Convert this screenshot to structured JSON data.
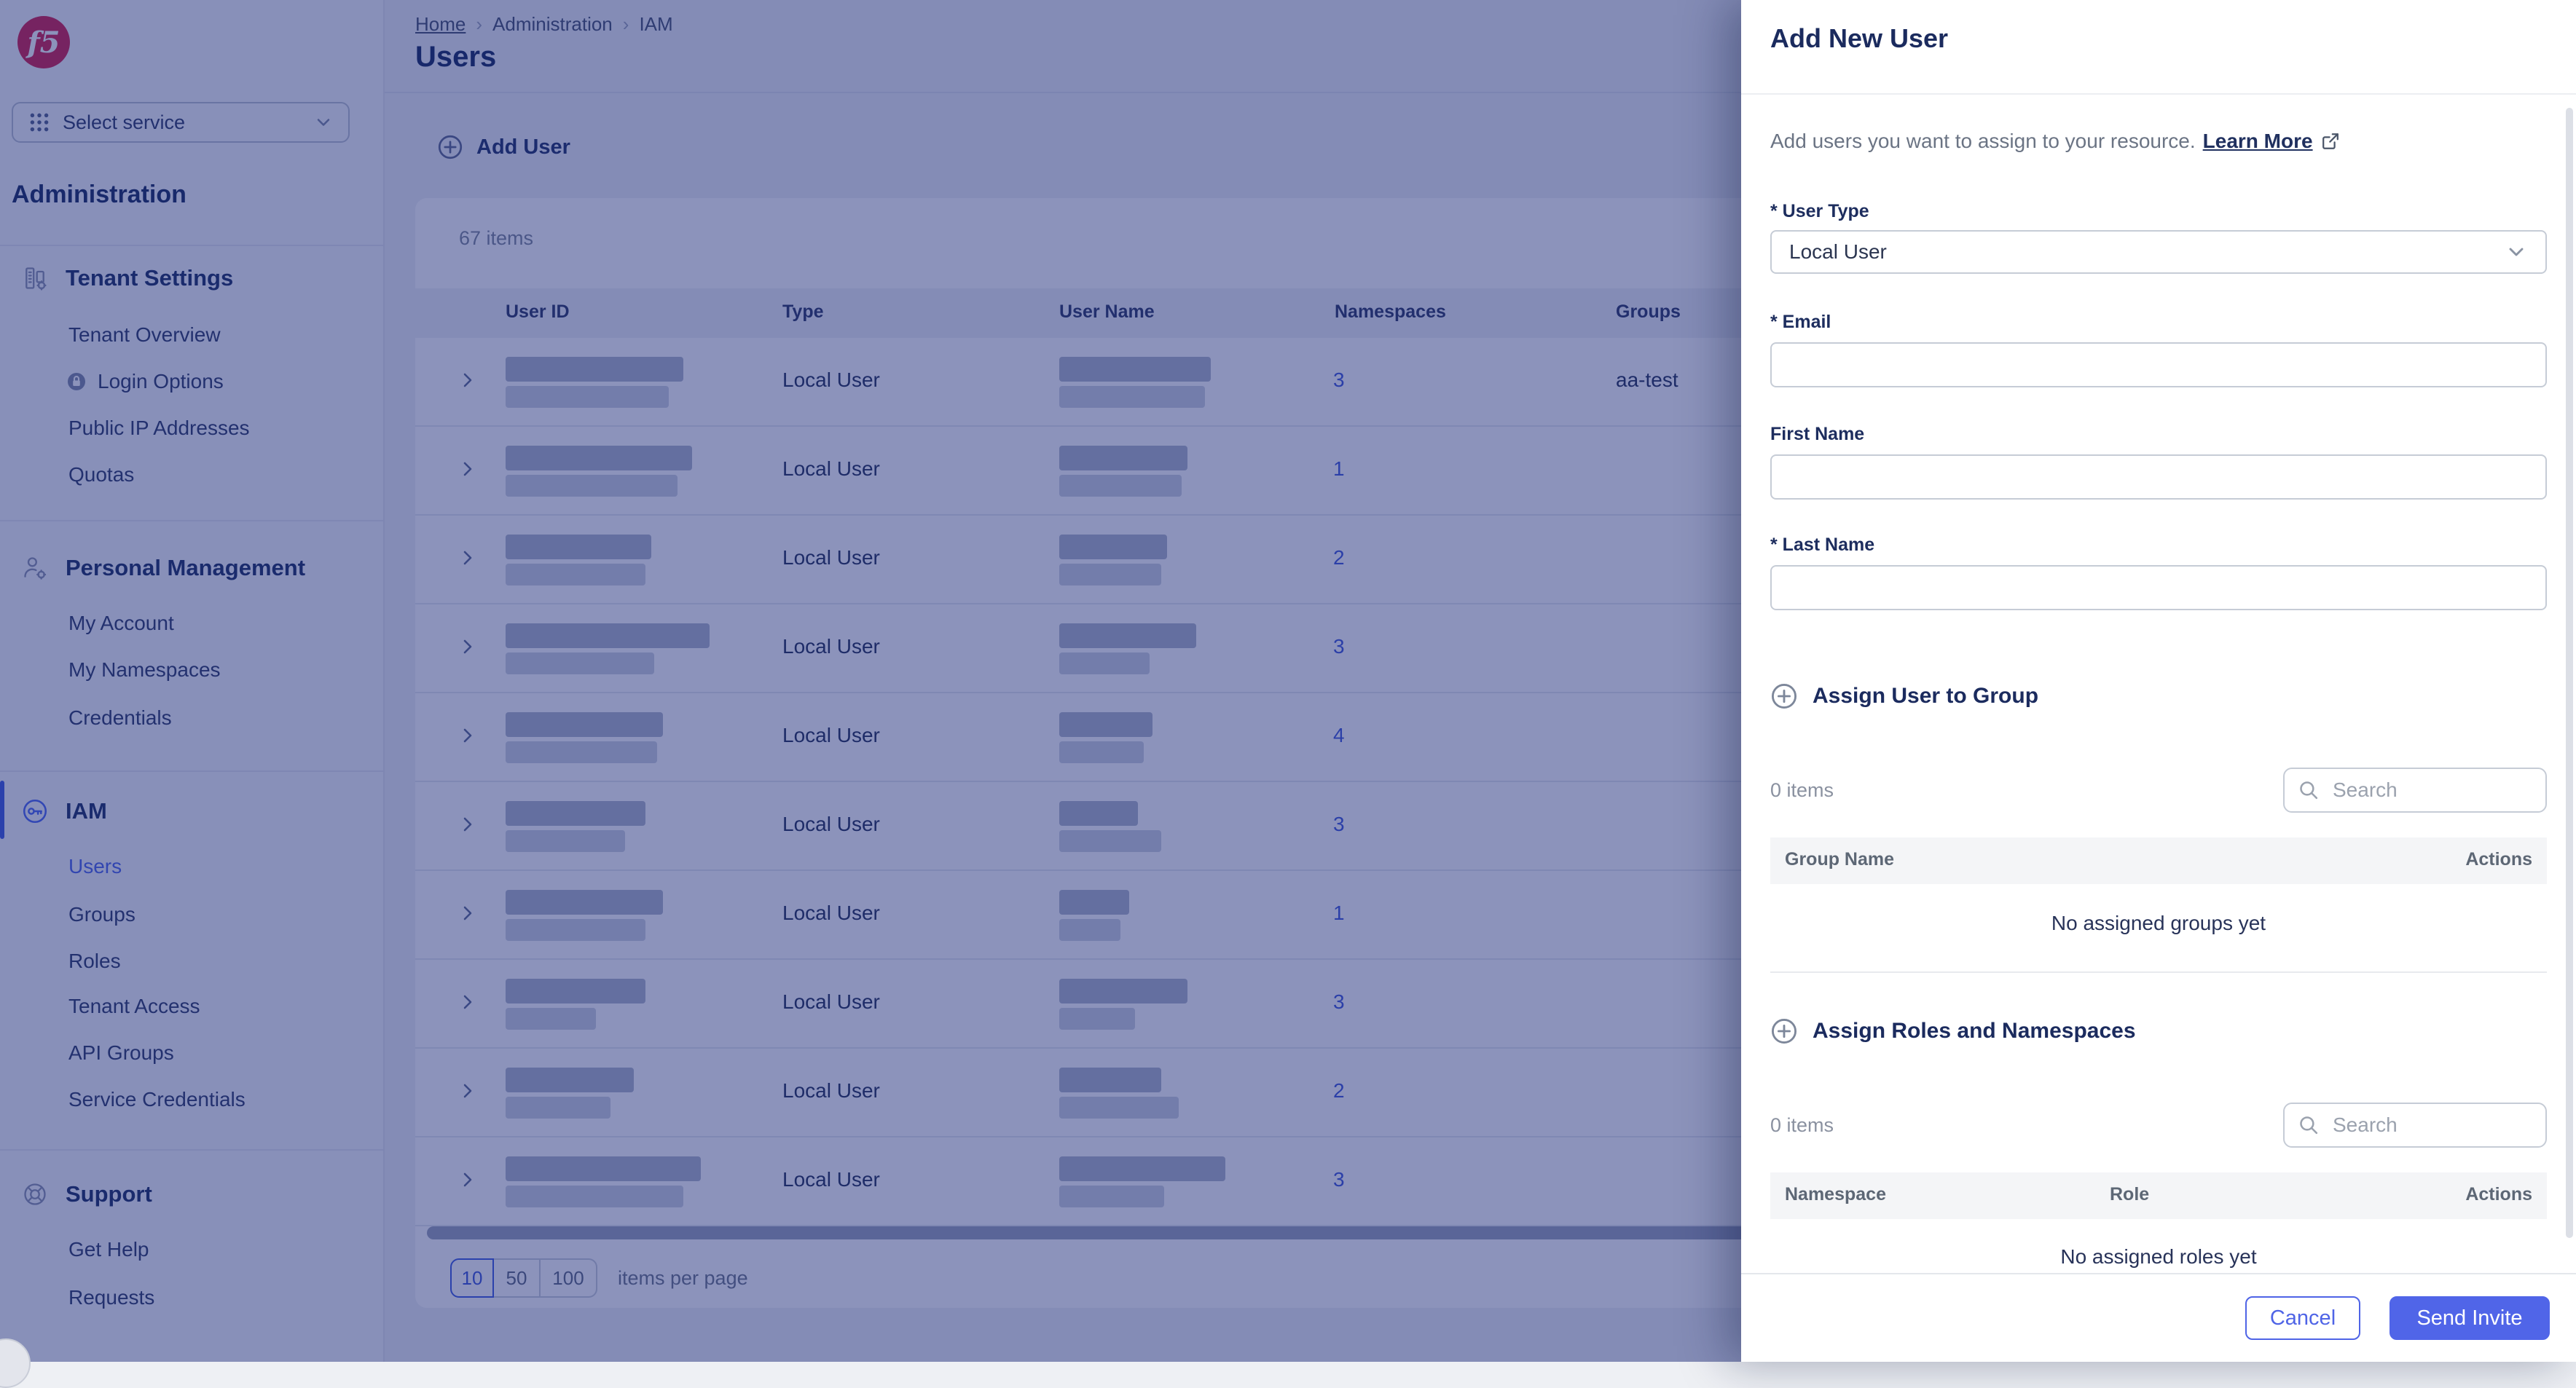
{
  "overlay": {
    "backdrop_color": "rgba(25,40,120,0.5)"
  },
  "brand": {
    "logo_text": "f5",
    "logo_color": "#d21e4b"
  },
  "sidebar": {
    "service_picker": {
      "label": "Select service"
    },
    "title": "Administration",
    "sections": [
      {
        "key": "tenant-settings",
        "label": "Tenant Settings",
        "icon": "building-gear-icon",
        "items": [
          {
            "key": "tenant-overview",
            "label": "Tenant Overview"
          },
          {
            "key": "login-options",
            "label": "Login Options",
            "icon": "lock-icon"
          },
          {
            "key": "public-ip-addresses",
            "label": "Public IP Addresses"
          },
          {
            "key": "quotas",
            "label": "Quotas"
          }
        ]
      },
      {
        "key": "personal-management",
        "label": "Personal Management",
        "icon": "user-gear-icon",
        "items": [
          {
            "key": "my-account",
            "label": "My Account"
          },
          {
            "key": "my-namespaces",
            "label": "My Namespaces"
          },
          {
            "key": "credentials",
            "label": "Credentials"
          }
        ]
      },
      {
        "key": "iam",
        "label": "IAM",
        "icon": "key-icon",
        "active": true,
        "items": [
          {
            "key": "users",
            "label": "Users",
            "active": true
          },
          {
            "key": "groups",
            "label": "Groups"
          },
          {
            "key": "roles",
            "label": "Roles"
          },
          {
            "key": "tenant-access",
            "label": "Tenant Access"
          },
          {
            "key": "api-groups",
            "label": "API Groups"
          },
          {
            "key": "service-credentials",
            "label": "Service Credentials"
          }
        ]
      },
      {
        "key": "support",
        "label": "Support",
        "icon": "lifebuoy-icon",
        "items": [
          {
            "key": "get-help",
            "label": "Get Help"
          },
          {
            "key": "requests",
            "label": "Requests"
          }
        ]
      }
    ]
  },
  "breadcrumb": {
    "separator": "›",
    "items": [
      {
        "label": "Home",
        "link": true
      },
      {
        "label": "Administration",
        "link": false
      },
      {
        "label": "IAM",
        "link": false
      }
    ]
  },
  "page": {
    "title": "Users",
    "add_user_label": "Add User"
  },
  "users_table": {
    "items_count": "67 items",
    "columns": [
      "User ID",
      "Type",
      "User Name",
      "Namespaces",
      "Groups"
    ],
    "rows": [
      {
        "type": "Local User",
        "namespaces": "3",
        "groups": "aa-test",
        "redacted": {
          "id1": 122,
          "id2": 112,
          "nm1": 104,
          "nm2": 100
        }
      },
      {
        "type": "Local User",
        "namespaces": "1",
        "groups": "",
        "redacted": {
          "id1": 128,
          "id2": 118,
          "nm1": 88,
          "nm2": 84
        }
      },
      {
        "type": "Local User",
        "namespaces": "2",
        "groups": "",
        "redacted": {
          "id1": 100,
          "id2": 96,
          "nm1": 74,
          "nm2": 70
        }
      },
      {
        "type": "Local User",
        "namespaces": "3",
        "groups": "",
        "redacted": {
          "id1": 140,
          "id2": 102,
          "nm1": 94,
          "nm2": 62
        }
      },
      {
        "type": "Local User",
        "namespaces": "4",
        "groups": "",
        "redacted": {
          "id1": 108,
          "id2": 104,
          "nm1": 64,
          "nm2": 58
        }
      },
      {
        "type": "Local User",
        "namespaces": "3",
        "groups": "",
        "redacted": {
          "id1": 96,
          "id2": 82,
          "nm1": 54,
          "nm2": 70
        }
      },
      {
        "type": "Local User",
        "namespaces": "1",
        "groups": "",
        "redacted": {
          "id1": 108,
          "id2": 96,
          "nm1": 48,
          "nm2": 42
        }
      },
      {
        "type": "Local User",
        "namespaces": "3",
        "groups": "",
        "redacted": {
          "id1": 96,
          "id2": 62,
          "nm1": 88,
          "nm2": 52
        }
      },
      {
        "type": "Local User",
        "namespaces": "2",
        "groups": "",
        "redacted": {
          "id1": 88,
          "id2": 72,
          "nm1": 70,
          "nm2": 82
        }
      },
      {
        "type": "Local User",
        "namespaces": "3",
        "groups": "",
        "redacted": {
          "id1": 134,
          "id2": 122,
          "nm1": 114,
          "nm2": 72
        }
      }
    ]
  },
  "pagination": {
    "options": [
      "10",
      "50",
      "100"
    ],
    "selected": "10",
    "label": "items per page"
  },
  "panel": {
    "title": "Add New User",
    "description": "Add users you want to assign to your resource.",
    "learn_more_label": "Learn More",
    "user_type": {
      "label": "* User Type",
      "value": "Local User"
    },
    "email": {
      "label": "* Email",
      "value": ""
    },
    "first_name": {
      "label": "First Name",
      "value": ""
    },
    "last_name": {
      "label": "* Last Name",
      "value": ""
    },
    "groups_section": {
      "title": "Assign User to Group",
      "items_count": "0 items",
      "search_placeholder": "Search",
      "columns": [
        "Group Name",
        "Actions"
      ],
      "empty_text": "No assigned groups yet"
    },
    "roles_section": {
      "title": "Assign Roles and Namespaces",
      "items_count": "0 items",
      "search_placeholder": "Search",
      "columns": [
        "Namespace",
        "Role",
        "Actions"
      ],
      "empty_text": "No assigned roles yet"
    },
    "footer": {
      "cancel_label": "Cancel",
      "submit_label": "Send Invite"
    },
    "accent_color": "#5065e8"
  }
}
